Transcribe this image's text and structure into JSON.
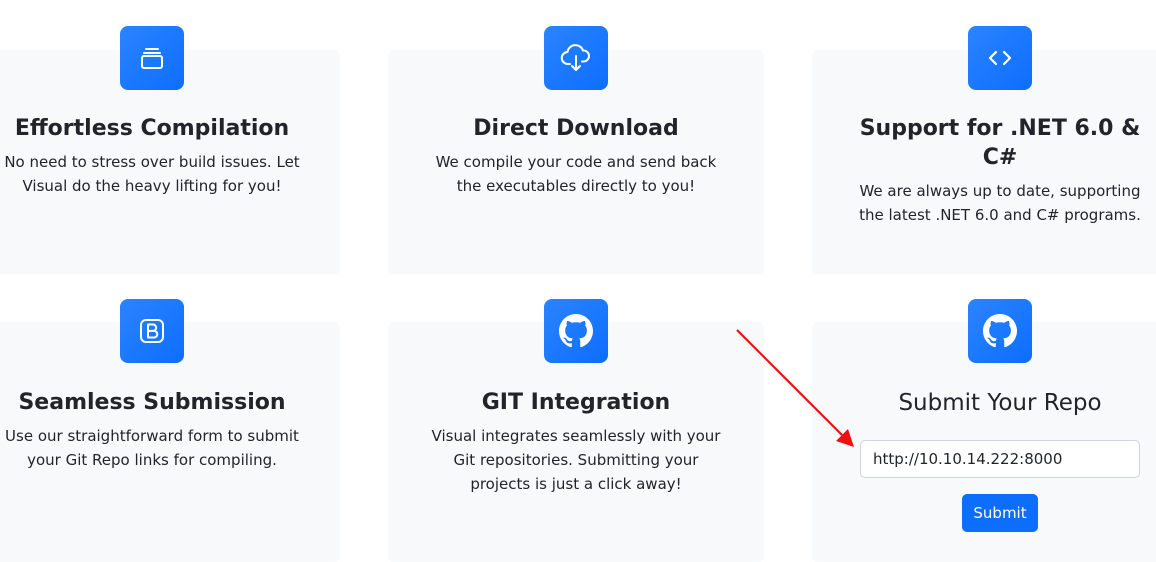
{
  "colors": {
    "accent": "#0d6efd",
    "card_background": "#f8f9fa",
    "annotation_arrow": "#ee1111"
  },
  "features": [
    {
      "icon": "window-stack-icon",
      "title": "Effortless Compilation",
      "line1": "No need to stress over build issues. Let",
      "line2": "Visual do the heavy lifting for you!"
    },
    {
      "icon": "cloud-download-icon",
      "title": "Direct Download",
      "line1": "We compile your code and send back",
      "line2": "the executables directly to you!"
    },
    {
      "icon": "code-brackets-icon",
      "title_line1": "Support for .NET 6.0 &",
      "title_line2": "C#",
      "line1": "We are always up to date, supporting",
      "line2": "the latest .NET 6.0 and C# programs."
    },
    {
      "icon": "bootstrap-b-icon",
      "title": "Seamless Submission",
      "line1": "Use our straightforward form to submit",
      "line2": "your Git Repo links for compiling."
    },
    {
      "icon": "github-icon",
      "title": "GIT Integration",
      "line1": "Visual integrates seamlessly with your",
      "line2": "Git repositories. Submitting your",
      "line3": "projects is just a click away!"
    }
  ],
  "submit_form": {
    "icon": "github-icon",
    "title": "Submit Your Repo",
    "repo_url_value": "http://10.10.14.222:8000",
    "submit_label": "Submit"
  }
}
